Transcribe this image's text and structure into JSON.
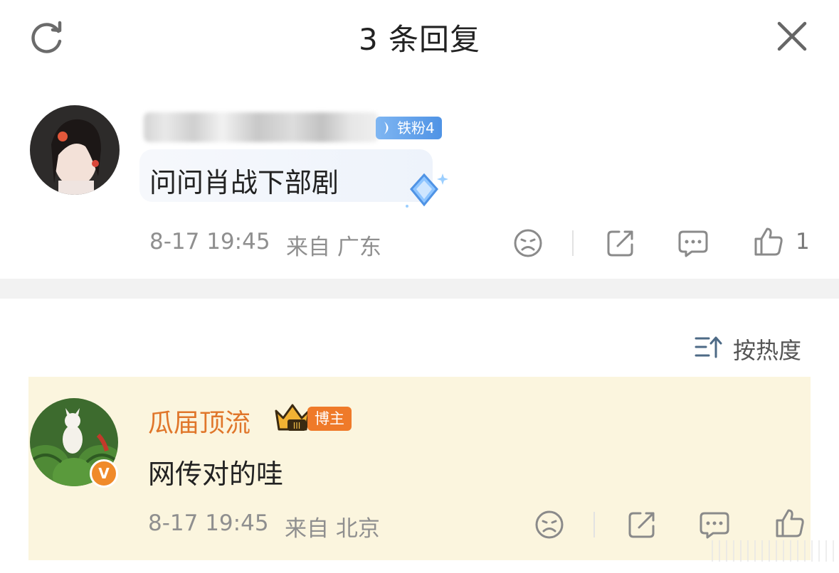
{
  "header": {
    "title": "3 条回复"
  },
  "root_comment": {
    "badge": "铁粉4",
    "text": "问问肖战下部剧",
    "time": "8-17 19:45",
    "location": "来自 广东",
    "like_count": "1"
  },
  "sort": {
    "label": "按热度"
  },
  "reply": {
    "author": "瓜届顶流",
    "role_badge": "博主",
    "text": "网传对的哇",
    "time": "8-17 19:45",
    "location": "来自 北京"
  },
  "colors": {
    "accent_orange": "#e0762a",
    "reply_background": "#fbf5de",
    "fan_badge_blue": "#4f93e5",
    "meta_gray": "#8f8f8f"
  }
}
